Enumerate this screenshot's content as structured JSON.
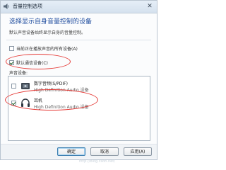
{
  "window": {
    "title": "音量控制选项",
    "close_glyph": "✕"
  },
  "header": {
    "heading": "选择显示自身音量控制的设备",
    "description": "默认声音设备始终显示自身的音量控制。"
  },
  "options": [
    {
      "label": "当前正在播放声音的所有设备(A)",
      "checked": false
    },
    {
      "label": "默认通信设备(C)",
      "checked": true
    }
  ],
  "devices_section": {
    "label": "声音设备:",
    "items": [
      {
        "name": "数字音频(S/PDIF)",
        "driver": "High Definition Audio 设备",
        "icon": "spdif-icon",
        "checked": false
      },
      {
        "name": "耳机",
        "driver": "High Definition Audio 设备",
        "icon": "headphones-icon",
        "checked": true
      }
    ],
    "watermark": "http://blog.csdn.net/"
  },
  "footer": {
    "ok_label": "确定",
    "cancel_label": "取消",
    "apply_label": "应用(A)"
  },
  "colors": {
    "heading": "#1f4c9e",
    "annotation": "#e53935"
  }
}
